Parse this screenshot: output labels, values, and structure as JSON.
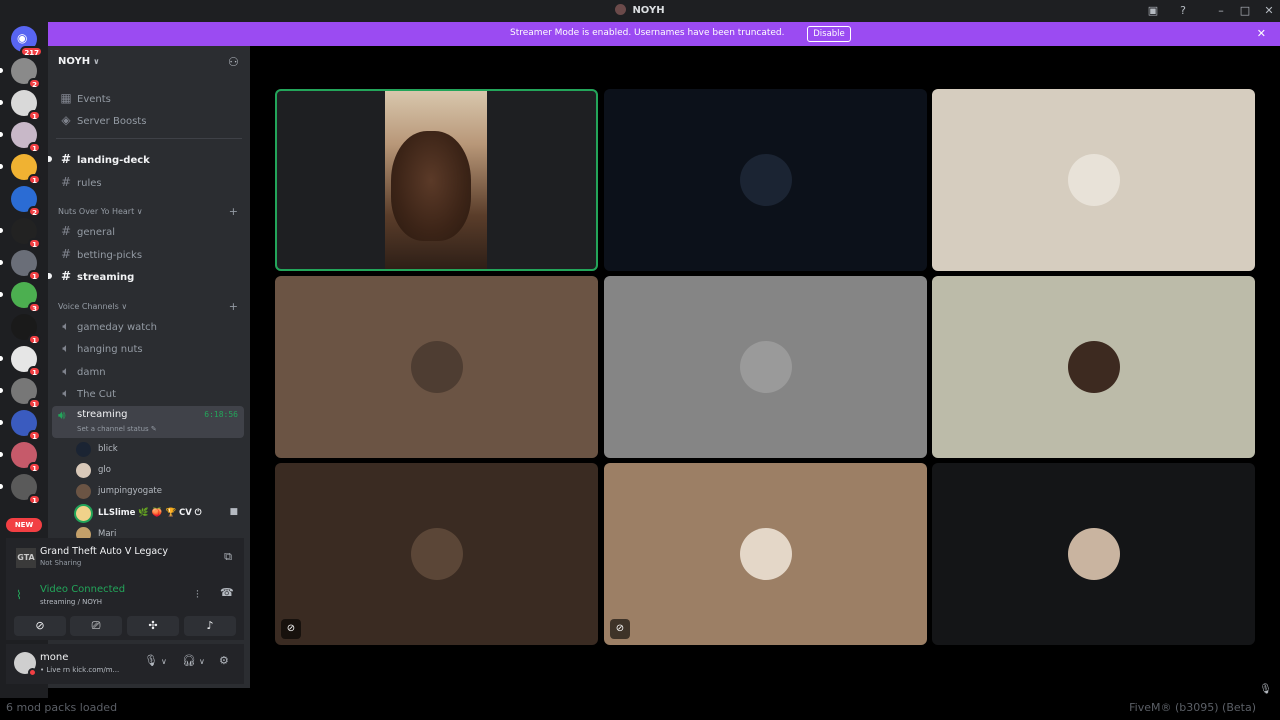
{
  "window": {
    "title": "NOYH"
  },
  "rail": {
    "home_badge": "217",
    "new_label": "NEW",
    "servers": [
      {
        "name": "server-1",
        "color": "#8a8a8a",
        "badge": "2",
        "pill": true
      },
      {
        "name": "server-2",
        "color": "#d9d9d9",
        "badge": "1",
        "pill": true
      },
      {
        "name": "server-3",
        "color": "#c8b8c8",
        "badge": "1",
        "pill": true
      },
      {
        "name": "server-4",
        "color": "#f0b232",
        "badge": "1",
        "pill": true
      },
      {
        "name": "server-5",
        "color": "#2b6cd4",
        "badge": "2",
        "pill": false
      },
      {
        "name": "server-6",
        "color": "#222222",
        "badge": "1",
        "pill": true
      },
      {
        "name": "server-7",
        "color": "#6a6e78",
        "badge": "1",
        "pill": true
      },
      {
        "name": "server-8",
        "color": "#4caf50",
        "badge": "3",
        "pill": true
      },
      {
        "name": "server-9",
        "color": "#1a1a1a",
        "badge": "1",
        "pill": false
      },
      {
        "name": "server-10",
        "color": "#e6e6e6",
        "badge": "1",
        "pill": true
      },
      {
        "name": "server-11",
        "color": "#777777",
        "badge": "1",
        "pill": true
      },
      {
        "name": "server-12",
        "color": "#3a5bbf",
        "badge": "1",
        "pill": true
      },
      {
        "name": "server-13",
        "color": "#c65a6a",
        "badge": "1",
        "pill": true
      },
      {
        "name": "server-14",
        "color": "#5a5a5a",
        "badge": "1",
        "pill": true
      }
    ]
  },
  "banner": {
    "message": "Streamer Mode is enabled. Usernames have been truncated.",
    "button": "Disable"
  },
  "sidebar": {
    "guild_name": "NOYH",
    "top_items": [
      "Events",
      "Server Boosts"
    ],
    "text_channels": [
      {
        "name": "landing-deck",
        "bold": true
      },
      {
        "name": "rules",
        "bold": false
      }
    ],
    "category1": "Nuts Over Yo Heart",
    "category1_channels": [
      {
        "name": "general",
        "bold": false
      },
      {
        "name": "betting-picks",
        "bold": false
      },
      {
        "name": "streaming",
        "bold": true
      }
    ],
    "category2": "Voice Channels",
    "voice_channels": [
      "gameday watch",
      "hanging nuts",
      "damn",
      "The Cut"
    ],
    "active_voice": {
      "name": "streaming",
      "timer": "6:18:56",
      "status": "Set a channel status"
    },
    "voice_users": [
      {
        "name": "blick",
        "color": "#1b2433"
      },
      {
        "name": "glo",
        "color": "#d8c8b8"
      },
      {
        "name": "jumpingyogate",
        "color": "#6b5444"
      },
      {
        "name": "LLSlime",
        "color": "#f0d28a",
        "speaking": true,
        "extra": "🌿 🍑 🏆 CV ⏻"
      },
      {
        "name": "Mari",
        "color": "#c4a06a"
      }
    ]
  },
  "activity": {
    "game": "Grand Theft Auto V Legacy",
    "state": "Not Sharing",
    "icon_text": "GTA"
  },
  "rtc": {
    "status": "Video Connected",
    "channel": "streaming / NOYH"
  },
  "user_panel": {
    "name": "mone",
    "status": "• Live rn kick.com/m..."
  },
  "tiles": [
    {
      "bg": "#1e1f22",
      "avatar": null,
      "speaking": true,
      "muted": false,
      "video": true
    },
    {
      "bg": "#0c111a",
      "avatar": "#1b2433",
      "speaking": false,
      "muted": false
    },
    {
      "bg": "#d6cdbf",
      "avatar": "#e8e2d8",
      "speaking": false,
      "muted": false
    },
    {
      "bg": "#6b5444",
      "avatar": "#4e3d32",
      "speaking": false,
      "muted": false
    },
    {
      "bg": "#858585",
      "avatar": "#9a9a9a",
      "speaking": false,
      "muted": false
    },
    {
      "bg": "#bcbba9",
      "avatar": "#3d2a20",
      "speaking": false,
      "muted": false
    },
    {
      "bg": "#3a2b22",
      "avatar": "#5b4637",
      "speaking": false,
      "muted": true
    },
    {
      "bg": "#9c7f65",
      "avatar": "#e4d7c8",
      "speaking": false,
      "muted": true
    },
    {
      "bg": "#141517",
      "avatar": "#c9b4a0",
      "speaking": false,
      "muted": false
    }
  ],
  "footer": {
    "left": "6 mod packs loaded",
    "right": "FiveM® (b3095) (Beta)"
  }
}
